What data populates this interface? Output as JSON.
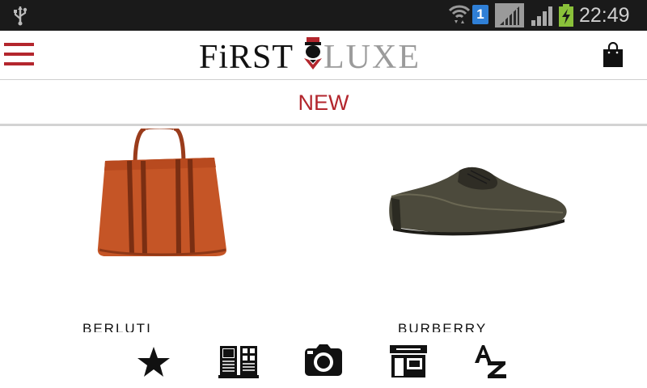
{
  "status_bar": {
    "time": "22:49",
    "notification_badge": "1",
    "icons": [
      "usb-icon",
      "wifi-icon",
      "notification-badge",
      "sim-icon",
      "signal-icon",
      "battery-charging-icon"
    ]
  },
  "header": {
    "logo_left": "FiRST",
    "logo_right": "LUXE",
    "icons": [
      "menu-icon",
      "shopping-bag-icon"
    ]
  },
  "section": {
    "title": "NEW"
  },
  "products": [
    {
      "brand": "BERLUTI",
      "image": "orange-suede-tote-bag"
    },
    {
      "brand": "BURBERRY",
      "image": "dark-leather-derby-shoe"
    }
  ],
  "bottom_nav": {
    "items": [
      "star-icon",
      "catalog-icon",
      "camera-icon",
      "store-icon",
      "az-sort-icon"
    ]
  },
  "colors": {
    "accent": "#b3262d",
    "status_bar": "#1a1a1a",
    "logo_grey": "#9b9b9b"
  }
}
